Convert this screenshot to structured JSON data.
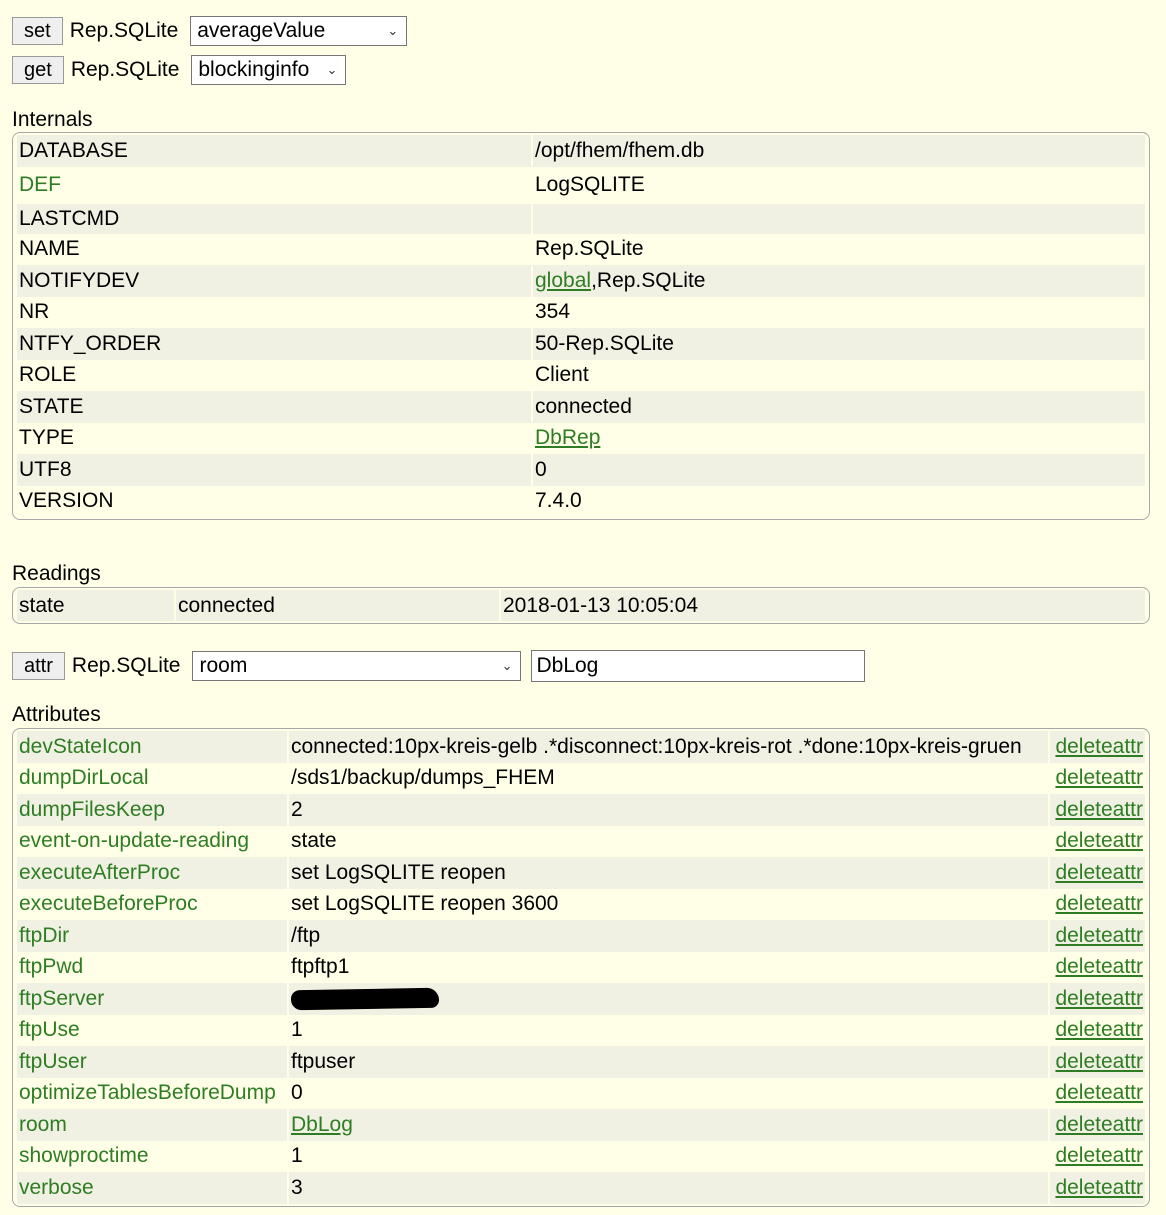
{
  "commands": {
    "set": {
      "button": "set",
      "device": "Rep.SQLite",
      "selected": "averageValue"
    },
    "get": {
      "button": "get",
      "device": "Rep.SQLite",
      "selected": "blockinginfo"
    },
    "attr": {
      "button": "attr",
      "device": "Rep.SQLite",
      "selected": "room",
      "value": "DbLog"
    }
  },
  "internals": {
    "title": "Internals",
    "rows": [
      {
        "key": "DATABASE",
        "value": "/opt/fhem/fhem.db"
      },
      {
        "key": "DEF",
        "value": "LogSQLITE"
      },
      {
        "key": "LASTCMD",
        "value": ""
      },
      {
        "key": "NAME",
        "value": "Rep.SQLite"
      },
      {
        "key": "NOTIFYDEV",
        "link": "global",
        "value": ",Rep.SQLite"
      },
      {
        "key": "NR",
        "value": "354"
      },
      {
        "key": "NTFY_ORDER",
        "value": "50-Rep.SQLite"
      },
      {
        "key": "ROLE",
        "value": "Client"
      },
      {
        "key": "STATE",
        "value": "connected"
      },
      {
        "key": "TYPE",
        "link": "DbRep"
      },
      {
        "key": "UTF8",
        "value": "0"
      },
      {
        "key": "VERSION",
        "value": "7.4.0"
      }
    ]
  },
  "readings": {
    "title": "Readings",
    "rows": [
      {
        "name": "state",
        "value": "connected",
        "time": "2018-01-13 10:05:04"
      }
    ]
  },
  "attributes": {
    "title": "Attributes",
    "delete_label": "deleteattr",
    "rows": [
      {
        "name": "devStateIcon",
        "value": "connected:10px-kreis-gelb .*disconnect:10px-kreis-rot .*done:10px-kreis-gruen"
      },
      {
        "name": "dumpDirLocal",
        "value": "/sds1/backup/dumps_FHEM"
      },
      {
        "name": "dumpFilesKeep",
        "value": "2"
      },
      {
        "name": "event-on-update-reading",
        "value": "state"
      },
      {
        "name": "executeAfterProc",
        "value": "set LogSQLITE reopen"
      },
      {
        "name": "executeBeforeProc",
        "value": "set LogSQLITE reopen 3600"
      },
      {
        "name": "ftpDir",
        "value": "/ftp"
      },
      {
        "name": "ftpPwd",
        "value": "ftpftp1"
      },
      {
        "name": "ftpServer",
        "redacted": true
      },
      {
        "name": "ftpUse",
        "value": "1"
      },
      {
        "name": "ftpUser",
        "value": "ftpuser"
      },
      {
        "name": "optimizeTablesBeforeDump",
        "value": "0"
      },
      {
        "name": "room",
        "link": "DbLog"
      },
      {
        "name": "showproctime",
        "value": "1"
      },
      {
        "name": "verbose",
        "value": "3"
      }
    ]
  }
}
